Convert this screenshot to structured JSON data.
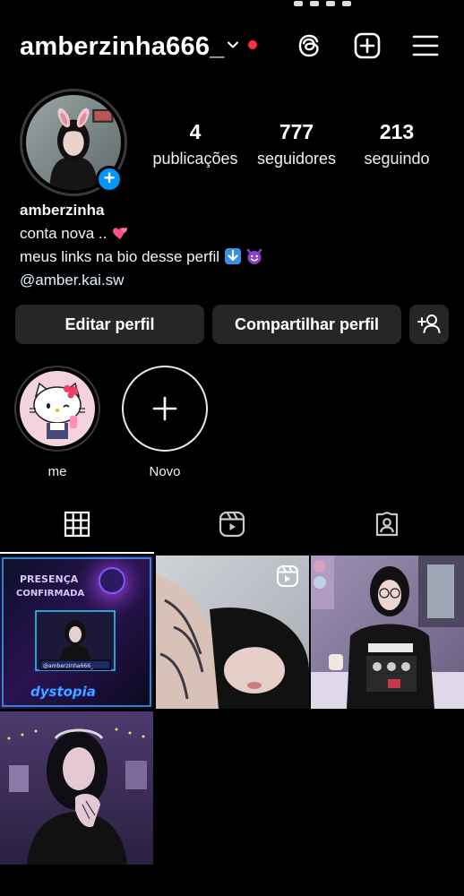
{
  "header": {
    "username": "amberzinha666_",
    "has_notification_dot": true,
    "colors": {
      "notification_dot": "#ff3040",
      "add_story_badge": "#0095f6"
    }
  },
  "stats": {
    "posts": {
      "value": "4",
      "label": "publicações"
    },
    "followers": {
      "value": "777",
      "label": "seguidores"
    },
    "following": {
      "value": "213",
      "label": "seguindo"
    }
  },
  "bio": {
    "name": "amberzinha",
    "line1": "conta nova ..",
    "line2": "meus links na bio desse perfil",
    "line3": "@amber.kai.sw"
  },
  "actions": {
    "edit_profile": "Editar perfil",
    "share_profile": "Compartilhar perfil"
  },
  "highlights": [
    {
      "label": "me",
      "icon": "hello-kitty"
    },
    {
      "label": "Novo",
      "icon": "plus-icon"
    }
  ],
  "tabs": [
    {
      "name": "posts",
      "icon": "grid-icon",
      "active": true
    },
    {
      "name": "reels",
      "icon": "reels-icon",
      "active": false
    },
    {
      "name": "tagged",
      "icon": "tagged-icon",
      "active": false
    }
  ],
  "posts": [
    {
      "type": "image",
      "caption_text": [
        "PRESENÇA",
        "CONFIRMADA",
        "@amberzinha666_",
        "dystopia"
      ]
    },
    {
      "type": "reel"
    },
    {
      "type": "image"
    },
    {
      "type": "image"
    }
  ]
}
